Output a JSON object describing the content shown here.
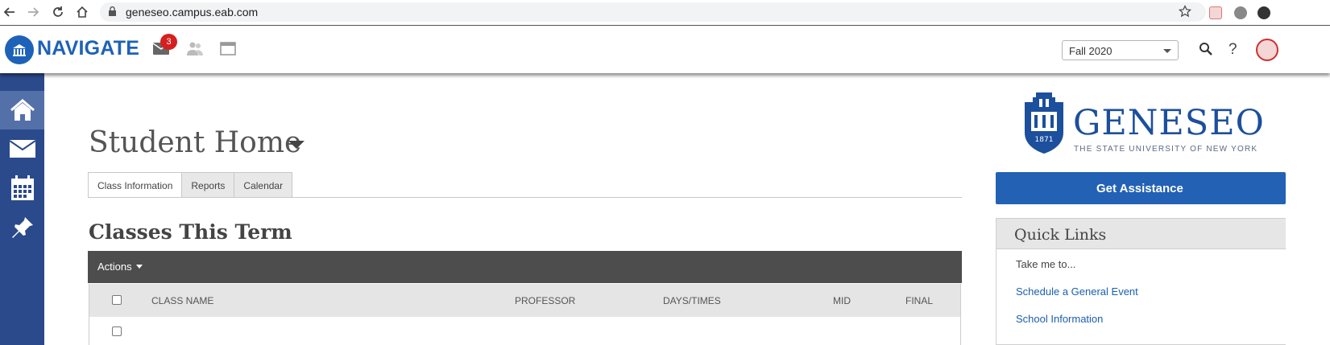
{
  "browser": {
    "url": "geneseo.campus.eab.com"
  },
  "header": {
    "brand": "NAVIGATE",
    "mail_badge_count": "3",
    "term_selected": "Fall 2020",
    "help_label": "?"
  },
  "sidebar": {
    "items": [
      {
        "icon": "home-icon"
      },
      {
        "icon": "mail-icon"
      },
      {
        "icon": "calendar-icon"
      },
      {
        "icon": "pin-icon"
      }
    ]
  },
  "main": {
    "page_title": "Student Home",
    "tabs": [
      "Class Information",
      "Reports",
      "Calendar"
    ],
    "section_title": "Classes This Term",
    "actions_label": "Actions",
    "table_headers": {
      "class_name": "CLASS NAME",
      "professor": "PROFESSOR",
      "days_times": "DAYS/TIMES",
      "mid": "MID",
      "final": "FINAL"
    }
  },
  "right": {
    "school_name": "GENESEO",
    "school_sub": "THE STATE UNIVERSITY OF NEW YORK",
    "seal_year": "1871",
    "assist_label": "Get Assistance",
    "quick_links_title": "Quick Links",
    "take_me_to": "Take me to...",
    "links": [
      "Schedule a General Event",
      "School Information"
    ]
  },
  "colors": {
    "brand_blue": "#1d62b8",
    "sidebar": "#2b4a8c",
    "actions_bar": "#4d4d4d",
    "badge_red": "#d42020"
  }
}
